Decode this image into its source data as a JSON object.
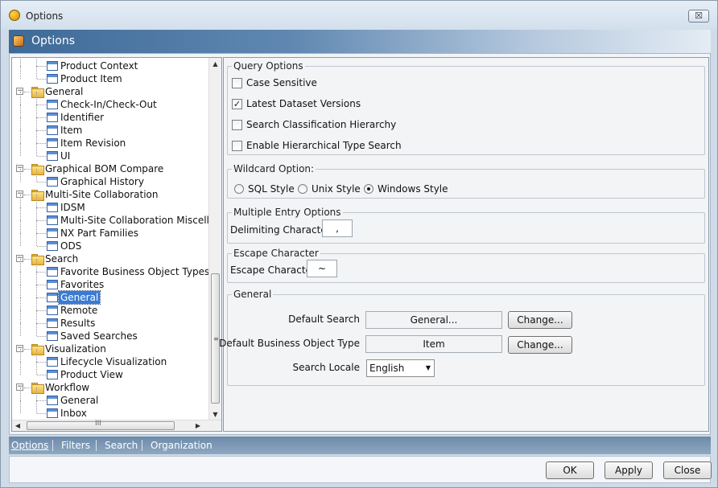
{
  "window": {
    "title": "Options",
    "close_glyph": "☒"
  },
  "banner": {
    "title": "Options"
  },
  "tree": {
    "rows": [
      {
        "type": "leaf",
        "label": "Product Context"
      },
      {
        "type": "leaf",
        "label": "Product Item"
      },
      {
        "type": "cat",
        "label": "General"
      },
      {
        "type": "leaf",
        "label": "Check-In/Check-Out"
      },
      {
        "type": "leaf",
        "label": "Identifier"
      },
      {
        "type": "leaf",
        "label": "Item"
      },
      {
        "type": "leaf",
        "label": "Item Revision"
      },
      {
        "type": "leaf",
        "label": "UI"
      },
      {
        "type": "cat",
        "label": "Graphical BOM Compare"
      },
      {
        "type": "leaf",
        "label": "Graphical History"
      },
      {
        "type": "cat",
        "label": "Multi-Site Collaboration"
      },
      {
        "type": "leaf",
        "label": "IDSM"
      },
      {
        "type": "leaf",
        "label": "Multi-Site Collaboration Miscellane"
      },
      {
        "type": "leaf",
        "label": "NX Part Families"
      },
      {
        "type": "leaf",
        "label": "ODS"
      },
      {
        "type": "cat",
        "label": "Search"
      },
      {
        "type": "leaf",
        "label": "Favorite Business Object Types"
      },
      {
        "type": "leaf",
        "label": "Favorites"
      },
      {
        "type": "leaf",
        "label": "General",
        "selected": true
      },
      {
        "type": "leaf",
        "label": "Remote"
      },
      {
        "type": "leaf",
        "label": "Results"
      },
      {
        "type": "leaf",
        "label": "Saved Searches"
      },
      {
        "type": "cat",
        "label": "Visualization"
      },
      {
        "type": "leaf",
        "label": "Lifecycle Visualization"
      },
      {
        "type": "leaf",
        "label": "Product View"
      },
      {
        "type": "cat",
        "label": "Workflow"
      },
      {
        "type": "leaf",
        "label": "General"
      },
      {
        "type": "leaf",
        "label": "Inbox"
      }
    ],
    "scroll_up": "▲",
    "scroll_down": "▼",
    "scroll_left": "◀",
    "scroll_right": "▶",
    "vgrip": "≡",
    "hgrip": "III"
  },
  "query_options": {
    "title": "Query Options",
    "items": [
      {
        "label": "Case Sensitive",
        "checked": false
      },
      {
        "label": "Latest Dataset Versions",
        "checked": true
      },
      {
        "label": "Search Classification Hierarchy",
        "checked": false
      },
      {
        "label": "Enable Hierarchical Type Search",
        "checked": false
      }
    ]
  },
  "wildcard": {
    "title": "Wildcard Option:",
    "options": [
      {
        "label": "SQL Style",
        "selected": false
      },
      {
        "label": "Unix Style",
        "selected": false
      },
      {
        "label": "Windows Style",
        "selected": true
      }
    ]
  },
  "multiple_entry": {
    "title": "Multiple Entry Options",
    "label": "Delimiting Character",
    "value": ","
  },
  "escape": {
    "title": "Escape Character",
    "label": "Escape Character",
    "value": "~"
  },
  "general": {
    "title": "General",
    "default_search_label": "Default Search",
    "default_search_value": "General...",
    "default_bo_label": "Default Business Object Type",
    "default_bo_value": "Item",
    "change_label": "Change...",
    "locale_label": "Search Locale",
    "locale_value": "English",
    "caret": "▼"
  },
  "tabs": [
    {
      "label": "Options",
      "active": true
    },
    {
      "label": "Filters",
      "active": false
    },
    {
      "label": "Search",
      "active": false
    },
    {
      "label": "Organization",
      "active": false
    }
  ],
  "buttons": {
    "ok": "OK",
    "apply": "Apply",
    "close": "Close"
  },
  "check_glyph": "✓"
}
